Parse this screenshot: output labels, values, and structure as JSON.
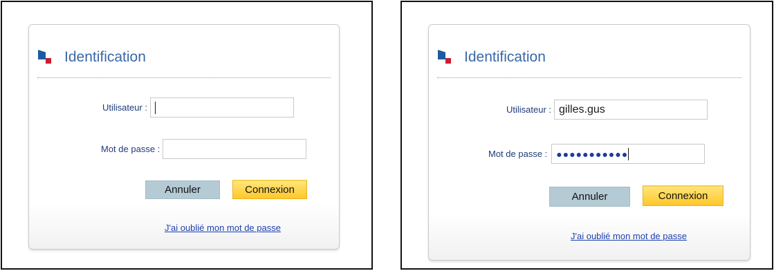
{
  "login_blank": {
    "title": "Identification",
    "username_label": "Utilisateur :",
    "username_value": "",
    "password_label": "Mot de passe :",
    "password_value": "",
    "cancel_label": "Annuler",
    "login_label": "Connexion",
    "forgot_link": "J'ai oublié mon mot de passe"
  },
  "login_filled": {
    "title": "Identification",
    "username_label": "Utilisateur :",
    "username_value": "gilles.gus",
    "password_label": "Mot de passe :",
    "password_mask": "●●●●●●●●●●●",
    "cancel_label": "Annuler",
    "login_label": "Connexion",
    "forgot_link": "J'ai oublié mon mot de passe"
  },
  "colors": {
    "brand_blue": "#1e5aa0",
    "brand_red": "#cc1d2e",
    "title_text": "#3a68a8",
    "label_text": "#1f3b7a",
    "cancel_button": "#b4cad4",
    "login_button": "#ffc72a",
    "link": "#1d3fb0"
  },
  "icons": {
    "logo": "brand-logo-icon"
  }
}
